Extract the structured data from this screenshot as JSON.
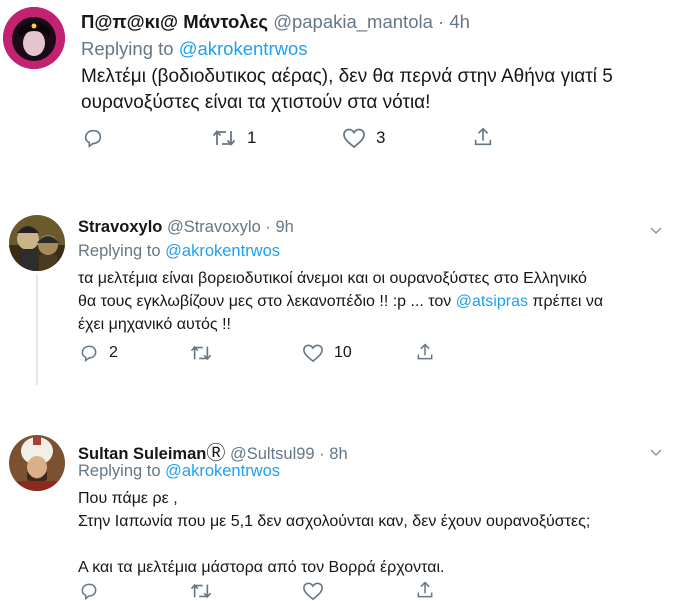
{
  "tweets": [
    {
      "name": "Π@π@κι@ Μάντολες",
      "handle": "@papakia_mantola",
      "sep": "·",
      "time": "4h",
      "replying_prefix": "Replying to",
      "replying_to": "@akrokentrwos",
      "body_lines": [
        "Μελτέμι (βοδιοδυτικος αέρας), δεν θα περνά στην Αθήνα γιατί 5",
        "ουρανοξύστες είναι τα χτιστούν στα νότια!"
      ],
      "reply_count": "",
      "retweet_count": "1",
      "like_count": "3"
    },
    {
      "name": "Stravoxylo",
      "handle": "@Stravoxylo",
      "sep": "·",
      "time": "9h",
      "replying_prefix": "Replying to",
      "replying_to": "@akrokentrwos",
      "body_lines": [
        "τα μελτέμια είναι βορειοδυτικοί άνεμοι και οι ουρανοξύστες στο Ελληνικό",
        "θα τους εγκλωβίζουν μες στο λεκανοπέδιο !! :p  ... τον ",
        "έχει μηχανικό αυτός  !!"
      ],
      "body_mention": "@atsipras",
      "body_line2_suffix": " πρέπει να",
      "reply_count": "2",
      "retweet_count": "",
      "like_count": "10"
    },
    {
      "name": "Sultan Suleiman",
      "name_badge": "Ⓡ",
      "handle": "@Sultsul99",
      "sep": "·",
      "time": "8h",
      "replying_prefix": "Replying to",
      "replying_to": "@akrokentrwos",
      "body_lines": [
        "Που πάμε ρε ,",
        "Στην Ιαπωνία που με 5,1 δεν ασχολούνται καν, δεν έχουν ουρανοξύστες;",
        "",
        "Α και τα μελτέμια μάστορα από τον Βορρά έρχονται."
      ]
    }
  ],
  "icons": {
    "reply": "reply-icon",
    "retweet": "retweet-icon",
    "like": "heart-icon",
    "share": "share-icon",
    "caret": "chevron-down-icon"
  },
  "colors": {
    "link": "#1da1f2",
    "secondary": "#657786",
    "text": "#14171a",
    "thread": "#e1e8ed"
  }
}
